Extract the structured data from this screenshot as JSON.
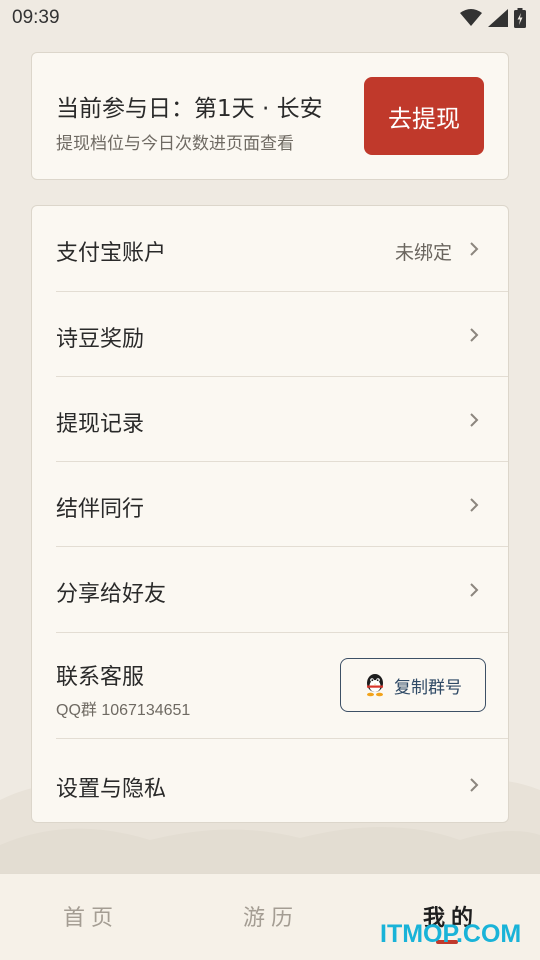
{
  "status_bar": {
    "time": "09:39"
  },
  "header_card": {
    "title": "当前参与日：第1天 · 长安",
    "subtitle": "提现档位与今日次数进页面查看",
    "button_label": "去提现"
  },
  "menu": {
    "alipay": {
      "label": "支付宝账户",
      "value": "未绑定"
    },
    "beans": {
      "label": "诗豆奖励"
    },
    "withdraw_records": {
      "label": "提现记录"
    },
    "companions": {
      "label": "结伴同行"
    },
    "share": {
      "label": "分享给好友"
    },
    "support": {
      "label": "联系客服",
      "sub": "QQ群 1067134651",
      "button_label": "复制群号"
    },
    "settings": {
      "label": "设置与隐私"
    }
  },
  "bottom_nav": {
    "items": [
      {
        "label": "首页",
        "active": false
      },
      {
        "label": "游历",
        "active": false
      },
      {
        "label": "我的",
        "active": true
      }
    ]
  },
  "watermark": "ITMOP.COM",
  "colors": {
    "accent": "#c0392b",
    "background": "#efeae2",
    "card": "#fbf8f2",
    "watermark": "#19b3d8"
  }
}
